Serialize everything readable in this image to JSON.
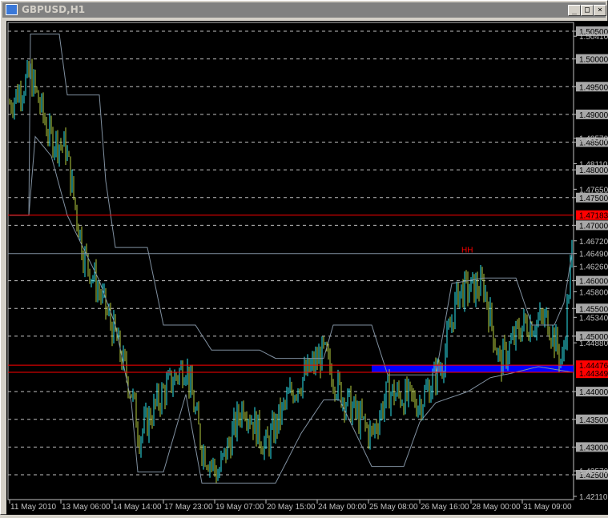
{
  "window": {
    "title": "GBPUSD,H1",
    "minimize_icon": "minimize-icon",
    "maximize_icon": "maximize-icon",
    "close_icon": "close-icon",
    "minimize": "_",
    "maximize": "□",
    "close": "×"
  },
  "colors": {
    "bull": "#2ee6f0",
    "bear": "#b8d040",
    "channel": "#8090a0",
    "grid": "#c0c0c0",
    "level": "#ff0000",
    "zone": "#0000ff",
    "label_bg": "#a8a8a8"
  },
  "annotation": {
    "text": "HH"
  },
  "chart_data": {
    "type": "bar",
    "symbol": "GBPUSD",
    "timeframe": "H1",
    "ylim": [
      1.4211,
      1.506
    ],
    "bars_count": 352,
    "grid_labels": [
      "1.50500",
      "1.50000",
      "1.49500",
      "1.49000",
      "1.48500",
      "1.48000",
      "1.47500",
      "1.47000",
      "1.46000",
      "1.45500",
      "1.45000",
      "1.44000",
      "1.43500",
      "1.43000",
      "1.42500"
    ],
    "grid_values": [
      1.505,
      1.5,
      1.495,
      1.49,
      1.485,
      1.48,
      1.475,
      1.47,
      1.46,
      1.455,
      1.45,
      1.44,
      1.435,
      1.43,
      1.425
    ],
    "extra_labels": [
      "1.50410",
      "1.48570",
      "1.48110",
      "1.47650",
      "1.46720",
      "1.46490",
      "1.46260",
      "1.45800",
      "1.45340",
      "1.44880",
      "1.42570",
      "1.42110"
    ],
    "red_labels": [
      "1.47183",
      "1.44476",
      "1.44349"
    ],
    "levels": {
      "resistance": 1.4649,
      "red_upper": 1.47183,
      "red_zone_top": 1.44476,
      "red_zone_bottom": 1.44349
    },
    "zone_start_bar": 226,
    "time_labels": [
      "11 May 2010",
      "13 May 06:00",
      "14 May 14:00",
      "17 May 23:00",
      "19 May 07:00",
      "20 May 15:00",
      "24 May 00:00",
      "25 May 08:00",
      "26 May 16:00",
      "28 May 00:00",
      "31 May 09:00"
    ],
    "time_label_bars": [
      0,
      32,
      64,
      96,
      128,
      160,
      192,
      224,
      256,
      288,
      320
    ],
    "close_path": [
      [
        0,
        1.492
      ],
      [
        13,
        1.497
      ],
      [
        25,
        1.486
      ],
      [
        35,
        1.484
      ],
      [
        40,
        1.475
      ],
      [
        46,
        1.465
      ],
      [
        56,
        1.458
      ],
      [
        66,
        1.45
      ],
      [
        76,
        1.44
      ],
      [
        81,
        1.432
      ],
      [
        96,
        1.44
      ],
      [
        110,
        1.445
      ],
      [
        120,
        1.43
      ],
      [
        130,
        1.425
      ],
      [
        146,
        1.438
      ],
      [
        160,
        1.43
      ],
      [
        176,
        1.44
      ],
      [
        196,
        1.447
      ],
      [
        206,
        1.44
      ],
      [
        226,
        1.432
      ],
      [
        236,
        1.44
      ],
      [
        256,
        1.438
      ],
      [
        270,
        1.445
      ],
      [
        280,
        1.458
      ],
      [
        296,
        1.459
      ],
      [
        306,
        1.445
      ],
      [
        320,
        1.452
      ],
      [
        336,
        1.453
      ],
      [
        345,
        1.445
      ],
      [
        351,
        1.465
      ]
    ],
    "upper_channel": [
      [
        0,
        1.4718
      ],
      [
        12,
        1.4718
      ],
      [
        13,
        1.5045
      ],
      [
        31,
        1.5045
      ],
      [
        36,
        1.4935
      ],
      [
        56,
        1.4935
      ],
      [
        60,
        1.478
      ],
      [
        66,
        1.466
      ],
      [
        86,
        1.466
      ],
      [
        96,
        1.452
      ],
      [
        116,
        1.452
      ],
      [
        126,
        1.4475
      ],
      [
        140,
        1.4475
      ],
      [
        156,
        1.4475
      ],
      [
        166,
        1.446
      ],
      [
        196,
        1.446
      ],
      [
        202,
        1.452
      ],
      [
        226,
        1.452
      ],
      [
        236,
        1.443
      ],
      [
        266,
        1.443
      ],
      [
        276,
        1.4595
      ],
      [
        296,
        1.4605
      ],
      [
        316,
        1.4605
      ],
      [
        326,
        1.452
      ],
      [
        340,
        1.452
      ],
      [
        346,
        1.456
      ],
      [
        351,
        1.4649
      ]
    ],
    "lower_channel": [
      [
        0,
        1.4718
      ],
      [
        12,
        1.4718
      ],
      [
        16,
        1.486
      ],
      [
        26,
        1.4825
      ],
      [
        36,
        1.4718
      ],
      [
        56,
        1.46
      ],
      [
        66,
        1.452
      ],
      [
        76,
        1.438
      ],
      [
        80,
        1.4255
      ],
      [
        96,
        1.4255
      ],
      [
        110,
        1.4395
      ],
      [
        120,
        1.4235
      ],
      [
        136,
        1.4235
      ],
      [
        160,
        1.4235
      ],
      [
        166,
        1.4235
      ],
      [
        182,
        1.4325
      ],
      [
        196,
        1.4385
      ],
      [
        206,
        1.4385
      ],
      [
        226,
        1.4265
      ],
      [
        246,
        1.4265
      ],
      [
        256,
        1.4345
      ],
      [
        266,
        1.438
      ],
      [
        286,
        1.44
      ],
      [
        300,
        1.4425
      ],
      [
        316,
        1.4435
      ],
      [
        330,
        1.4445
      ],
      [
        351,
        1.4435
      ]
    ]
  }
}
